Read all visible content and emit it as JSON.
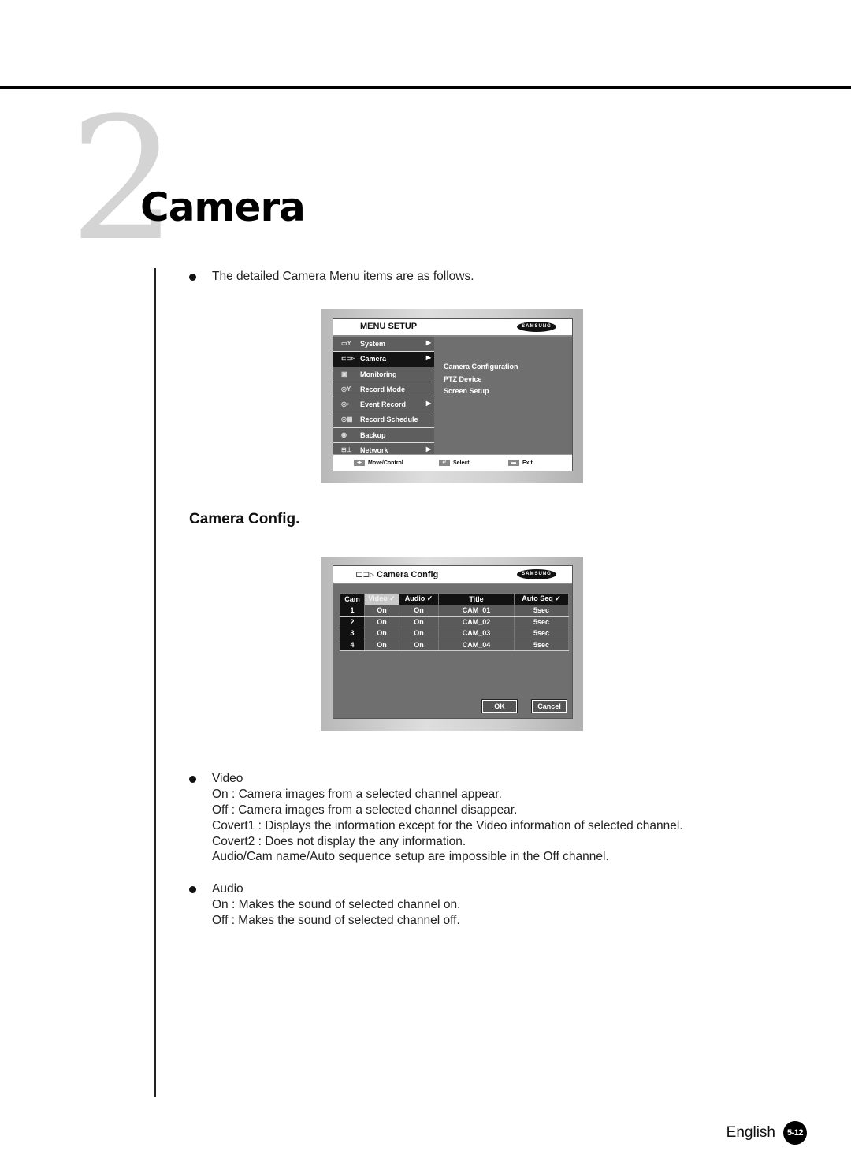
{
  "chapter": {
    "number": "2",
    "title": "Camera"
  },
  "intro": {
    "text": "The detailed Camera Menu items are as follows."
  },
  "menu_setup_screen": {
    "title": "MENU SETUP",
    "brand": "SAMSUNG",
    "items": [
      {
        "label": "System",
        "icon": "system-icon",
        "has_submenu": true,
        "active": false
      },
      {
        "label": "Camera",
        "icon": "camera-icon",
        "has_submenu": true,
        "active": true
      },
      {
        "label": "Monitoring",
        "icon": "monitor-icon",
        "has_submenu": false,
        "active": false
      },
      {
        "label": "Record Mode",
        "icon": "record-mode-icon",
        "has_submenu": false,
        "active": false
      },
      {
        "label": "Event Record",
        "icon": "event-record-icon",
        "has_submenu": true,
        "active": false
      },
      {
        "label": "Record Schedule",
        "icon": "record-schedule-icon",
        "has_submenu": false,
        "active": false
      },
      {
        "label": "Backup",
        "icon": "backup-icon",
        "has_submenu": false,
        "active": false
      },
      {
        "label": "Network",
        "icon": "network-icon",
        "has_submenu": true,
        "active": false
      }
    ],
    "submenu": [
      "Camera Configuration",
      "PTZ Device",
      "Screen Setup"
    ],
    "footer": {
      "move": "Move/Control",
      "select": "Select",
      "exit": "Exit"
    }
  },
  "section": {
    "heading": "Camera Config."
  },
  "camera_config_screen": {
    "title": "Camera Config",
    "brand": "SAMSUNG",
    "columns": [
      "Cam",
      "Video ✓",
      "Audio ✓",
      "Title",
      "Auto Seq  ✓"
    ],
    "rows": [
      {
        "cam": "1",
        "video": "On",
        "audio": "On",
        "title": "CAM_01",
        "auto_seq": "5sec"
      },
      {
        "cam": "2",
        "video": "On",
        "audio": "On",
        "title": "CAM_02",
        "auto_seq": "5sec"
      },
      {
        "cam": "3",
        "video": "On",
        "audio": "On",
        "title": "CAM_03",
        "auto_seq": "5sec"
      },
      {
        "cam": "4",
        "video": "On",
        "audio": "On",
        "title": "CAM_04",
        "auto_seq": "5sec"
      }
    ],
    "ok_label": "OK",
    "cancel_label": "Cancel"
  },
  "video_section": {
    "heading": "Video",
    "lines": [
      "On : Camera images from a selected channel appear.",
      "Off : Camera images from a selected channel disappear.",
      "Covert1 : Displays the information except for the Video information of selected channel.",
      "Covert2 : Does not display the any information.",
      "Audio/Cam name/Auto sequence setup are impossible in the Off channel."
    ]
  },
  "audio_section": {
    "heading": "Audio",
    "lines": [
      "On : Makes the sound of selected channel on.",
      "Off : Makes the sound of selected channel off."
    ]
  },
  "footer": {
    "language": "English",
    "page": "5-12"
  }
}
